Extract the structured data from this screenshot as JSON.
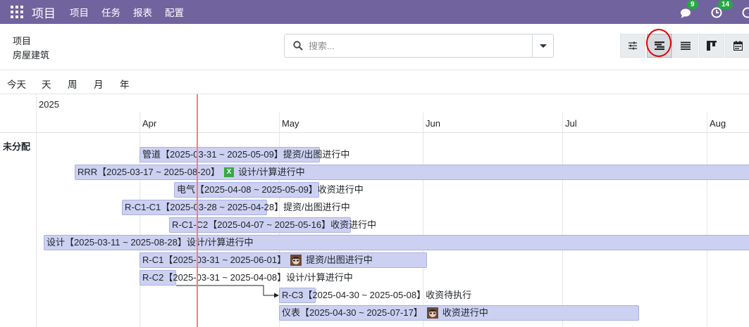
{
  "navbar": {
    "brand": "项目",
    "menu": [
      "项目",
      "任务",
      "报表",
      "配置"
    ],
    "chat_badge": "9",
    "activity_badge": "14",
    "colors": {
      "bg": "#71639e",
      "badge": "#28a745"
    }
  },
  "breadcrumb": {
    "parent": "项目",
    "current": "房屋建筑"
  },
  "search": {
    "placeholder": "搜索..."
  },
  "views": [
    "settings-sliders-icon",
    "gantt-icon",
    "list-icon",
    "kanban-icon",
    "calendar-icon"
  ],
  "scales": [
    "今天",
    "天",
    "周",
    "月",
    "年"
  ],
  "gantt": {
    "year": "2025",
    "months": [
      "Apr",
      "May",
      "Jun",
      "Jul",
      "Aug"
    ],
    "group": "未分配",
    "tasks": [
      {
        "label": "管道【2025-03-31 ~ 2025-05-09】提资/出图进行中"
      },
      {
        "label": "RRR【2025-03-17 ~ 2025-08-20】",
        "suffix": "设计/计算进行中"
      },
      {
        "label": "电气【2025-04-08 ~ 2025-05-09】收资进行中"
      },
      {
        "label": "R-C1-C1【2025-03-28 ~ 2025-04-28】提资/出图进行中"
      },
      {
        "label": "R-C1-C2【2025-04-07 ~ 2025-05-16】收资进行中"
      },
      {
        "label": "设计【2025-03-11 ~ 2025-08-28】设计/计算进行中"
      },
      {
        "label": "R-C1【2025-03-31 ~ 2025-06-01】",
        "suffix": "提资/出图进行中"
      },
      {
        "label": "R-C2【2025-03-31 ~ 2025-04-08】设计/计算进行中"
      },
      {
        "label": "R-C3【2025-04-30 ~ 2025-05-08】收资待执行"
      },
      {
        "label": "仪表【2025-04-30 ~ 2025-07-17】",
        "suffix": "收资进行中"
      }
    ],
    "colors": {
      "pill": "#ccd1f2",
      "today": "#f08080"
    }
  }
}
